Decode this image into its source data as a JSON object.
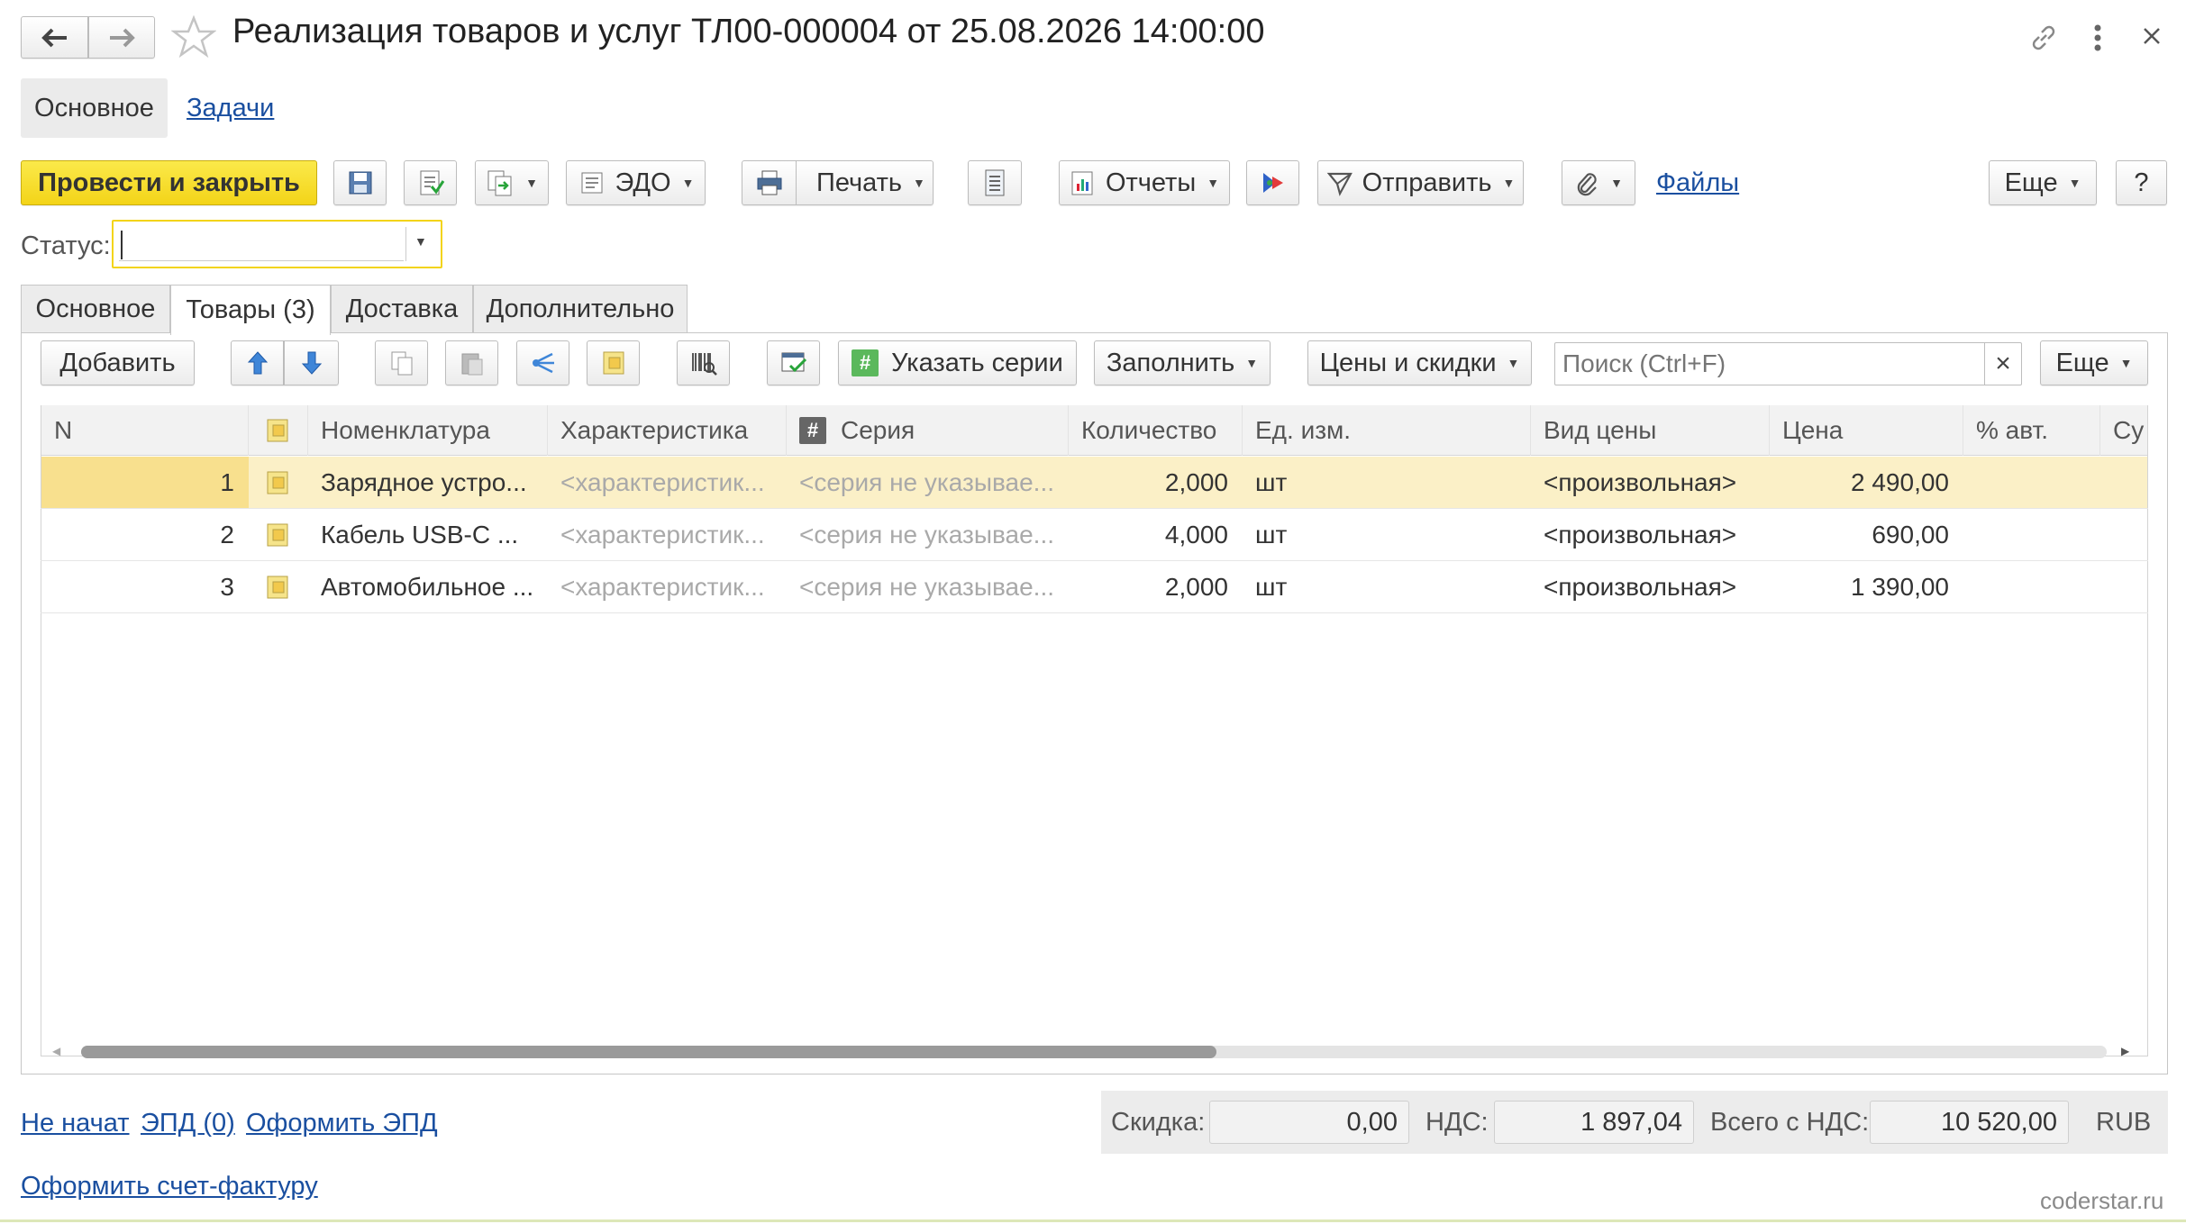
{
  "header": {
    "title": "Реализация товаров и услуг ТЛ00-000004 от 25.08.2026 14:00:00"
  },
  "nav": {
    "main": "Основное",
    "tasks": "Задачи"
  },
  "toolbar": {
    "post_close": "Провести и закрыть",
    "edo": "ЭДО",
    "print": "Печать",
    "reports": "Отчеты",
    "send": "Отправить",
    "files": "Файлы",
    "more": "Еще",
    "help": "?"
  },
  "status": {
    "label": "Статус:",
    "value": ""
  },
  "tabs": [
    {
      "label": "Основное"
    },
    {
      "label": "Товары (3)"
    },
    {
      "label": "Доставка"
    },
    {
      "label": "Дополнительно"
    }
  ],
  "table_toolbar": {
    "add": "Добавить",
    "series": "Указать серии",
    "fill": "Заполнить",
    "prices": "Цены и скидки",
    "search_placeholder": "Поиск (Ctrl+F)",
    "clear": "×",
    "more": "Еще"
  },
  "table": {
    "columns": [
      "N",
      "Номенклатура",
      "Характеристика",
      "Серия",
      "Количество",
      "Ед. изм.",
      "Вид цены",
      "Цена",
      "% авт.",
      "Су"
    ],
    "rows": [
      {
        "n": "1",
        "name": "Зарядное устро...",
        "char": "<характеристик...",
        "series": "<серия не указывае...",
        "qty": "2,000",
        "unit": "шт",
        "price_type": "<произвольная>",
        "price": "2 490,00",
        "auto": ""
      },
      {
        "n": "2",
        "name": "Кабель USB-C ...",
        "char": "<характеристик...",
        "series": "<серия не указывае...",
        "qty": "4,000",
        "unit": "шт",
        "price_type": "<произвольная>",
        "price": "690,00",
        "auto": ""
      },
      {
        "n": "3",
        "name": "Автомобильное ...",
        "char": "<характеристик...",
        "series": "<серия не указывае...",
        "qty": "2,000",
        "unit": "шт",
        "price_type": "<произвольная>",
        "price": "1 390,00",
        "auto": ""
      }
    ]
  },
  "footer": {
    "not_started": "Не начат",
    "epd": "ЭПД (0)",
    "make_epd": "Оформить ЭПД",
    "make_invoice": "Оформить счет-фактуру",
    "discount_label": "Скидка:",
    "discount": "0,00",
    "vat_label": "НДС:",
    "vat": "1 897,04",
    "total_label": "Всего с НДС:",
    "total": "10 520,00",
    "currency": "RUB",
    "watermark": "coderstar.ru"
  },
  "colors": {
    "primary_button": "#f9e43a",
    "selected_row": "#fbf0c7",
    "link": "#1a4fa0"
  }
}
